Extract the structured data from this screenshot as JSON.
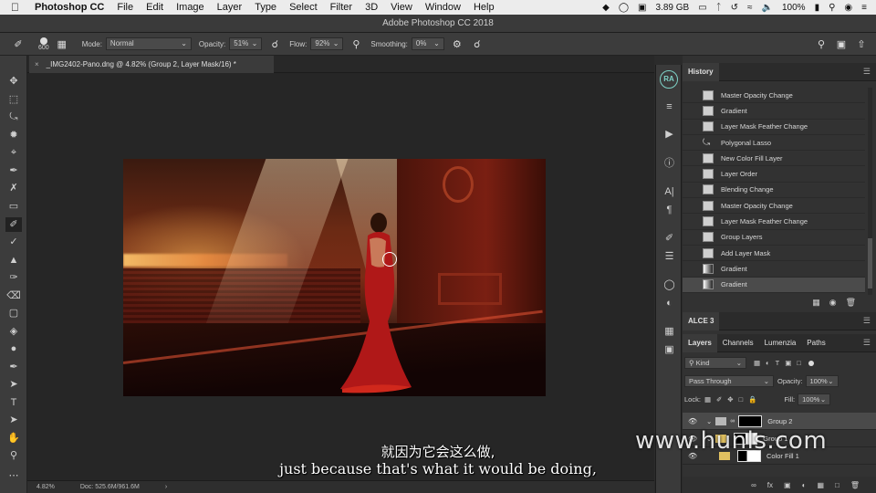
{
  "menubar": {
    "app": "Photoshop CC",
    "items": [
      "File",
      "Edit",
      "Image",
      "Layer",
      "Type",
      "Select",
      "Filter",
      "3D",
      "View",
      "Window",
      "Help"
    ],
    "memory": "3.89 GB",
    "battery": "100%"
  },
  "window_title": "Adobe Photoshop CC 2018",
  "options": {
    "brush_size": "600",
    "mode_label": "Mode:",
    "mode_value": "Normal",
    "opacity_label": "Opacity:",
    "opacity_value": "51%",
    "flow_label": "Flow:",
    "flow_value": "92%",
    "smoothing_label": "Smoothing:",
    "smoothing_value": "0%"
  },
  "document": {
    "tab_title": "_IMG2402-Pano.dng @ 4.82% (Group 2, Layer Mask/16) *",
    "zoom": "4.82%",
    "doc_size": "Doc: 525.6M/961.6M"
  },
  "history": {
    "tab": "History",
    "items": [
      {
        "label": "Master Opacity Change",
        "active": false
      },
      {
        "label": "Gradient",
        "active": false
      },
      {
        "label": "Layer Mask Feather Change",
        "active": false
      },
      {
        "label": "Polygonal Lasso",
        "active": false
      },
      {
        "label": "New Color Fill Layer",
        "active": false
      },
      {
        "label": "Layer Order",
        "active": false
      },
      {
        "label": "Blending Change",
        "active": false
      },
      {
        "label": "Master Opacity Change",
        "active": false
      },
      {
        "label": "Layer Mask Feather Change",
        "active": false
      },
      {
        "label": "Group Layers",
        "active": false
      },
      {
        "label": "Add Layer Mask",
        "active": false
      },
      {
        "label": "Gradient",
        "active": false
      },
      {
        "label": "Gradient",
        "active": true
      }
    ]
  },
  "alce": {
    "tab": "ALCE 3"
  },
  "layers_panel": {
    "tabs": [
      "Layers",
      "Channels",
      "Lumenzia",
      "Paths"
    ],
    "filter": "Kind",
    "blend_mode": "Pass Through",
    "opacity_label": "Opacity:",
    "opacity_value": "100%",
    "lock_label": "Lock:",
    "fill_label": "Fill:",
    "fill_value": "100%",
    "layers": [
      {
        "name": "Group 2",
        "active": true
      },
      {
        "name": "Group 1",
        "active": false
      },
      {
        "name": "Color Fill 1",
        "active": false
      }
    ]
  },
  "subtitles": {
    "cn": "就因为它会这么做,",
    "en": "just because that's what it would be doing,"
  },
  "watermark": "www.hunls.com",
  "avatar_initials": "RA"
}
